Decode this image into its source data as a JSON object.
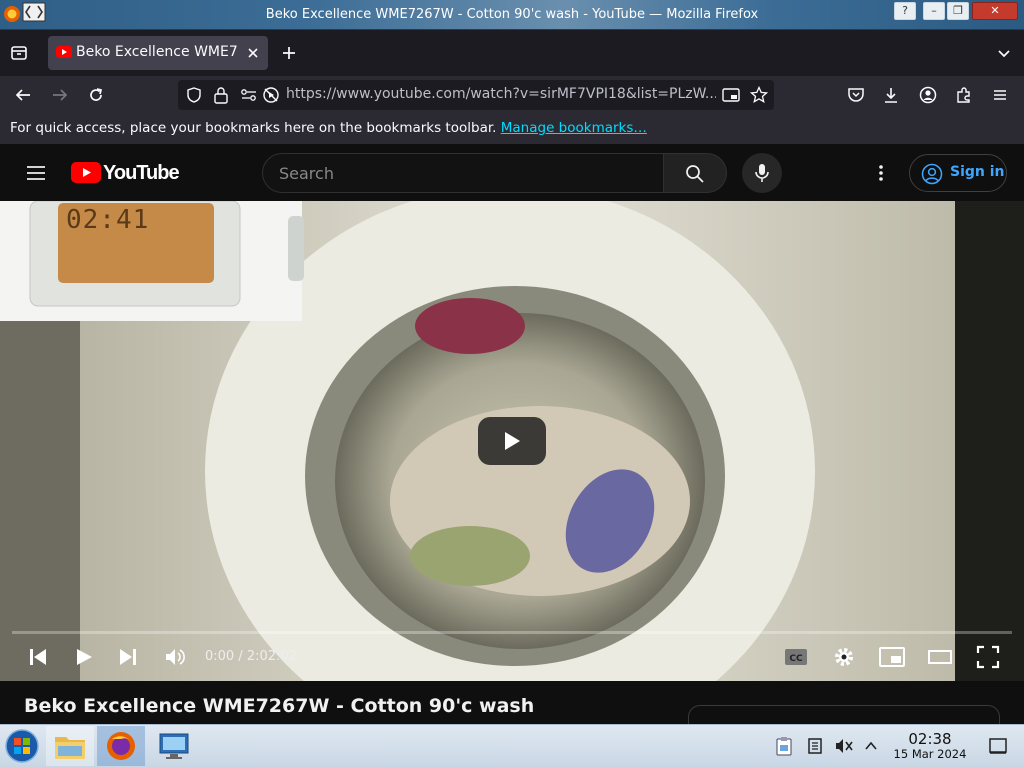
{
  "window": {
    "title": "Beko Excellence WME7267W - Cotton 90'c wash - YouTube — Mozilla Firefox",
    "help_label": "?",
    "minimize_label": "–",
    "maximize_label": "❐",
    "close_label": "✕"
  },
  "tabs": [
    {
      "label": "Beko Excellence WME7267W - Cotton 90'c wash - YouTube",
      "favicon": "youtube-favicon"
    }
  ],
  "navbar": {
    "url": "https://www.youtube.com/watch?v=sirMF7VPI18&list=PLzW..."
  },
  "bookmarks_bar": {
    "message": "For quick access, place your bookmarks here on the bookmarks toolbar.",
    "link": "Manage bookmarks…"
  },
  "youtube": {
    "logo_text": "YouTube",
    "search_placeholder": "Search",
    "signin_label": "Sign in"
  },
  "player": {
    "time": "0:00 / 2:02:02",
    "progress": 0,
    "display_time": "02:41"
  },
  "video": {
    "title": "Beko Excellence WME7267W - Cotton 90'c wash"
  },
  "taskbar": {
    "time": "02:38",
    "date": "15 Mar 2024"
  },
  "colors": {
    "accent_link": "#00ddff",
    "youtube_red": "#ff0000",
    "signin_blue": "#3ea6ff"
  }
}
